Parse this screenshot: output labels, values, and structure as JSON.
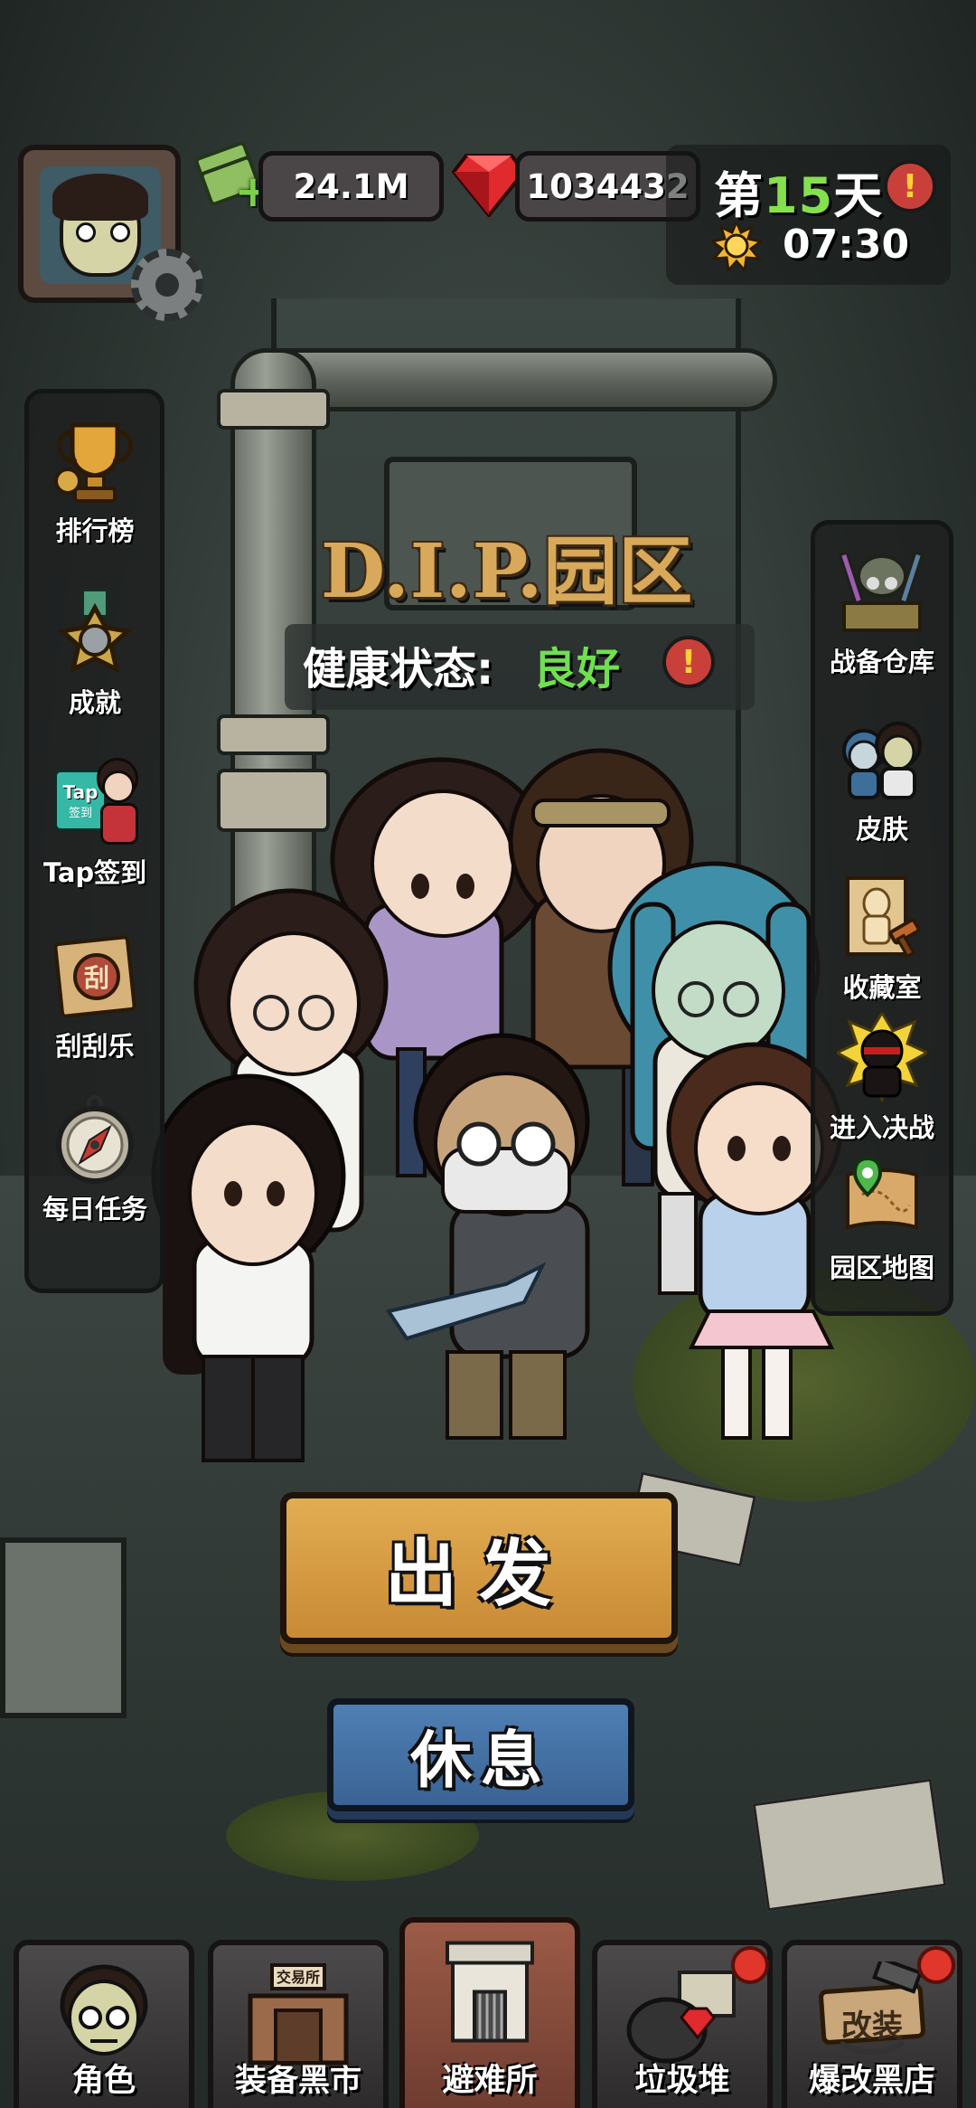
{
  "hud": {
    "money": "24.1M",
    "gems": "1034432",
    "day_prefix": "第",
    "day_number": "15",
    "day_suffix": "天",
    "time": "07:30",
    "alert_glyph": "!"
  },
  "title": "D.I.P.园区",
  "status": {
    "label": "健康状态:",
    "value": "良好",
    "value_color": "#6fe04e"
  },
  "left_menu": [
    {
      "label": "排行榜",
      "icon": "trophy-icon"
    },
    {
      "label": "成就",
      "icon": "medal-icon"
    },
    {
      "label": "Tap签到",
      "icon": "tap-checkin-icon",
      "badge": "Tap",
      "badge_sub": "签到"
    },
    {
      "label": "刮刮乐",
      "icon": "scratch-card-icon",
      "glyph": "刮"
    },
    {
      "label": "每日任务",
      "icon": "compass-icon"
    }
  ],
  "right_menu": [
    {
      "label": "战备仓库",
      "icon": "armory-icon"
    },
    {
      "label": "皮肤",
      "icon": "skin-icon"
    },
    {
      "label": "收藏室",
      "icon": "collection-icon"
    },
    {
      "label": "进入决战",
      "icon": "final-battle-icon"
    },
    {
      "label": "园区地图",
      "icon": "map-icon"
    }
  ],
  "buttons": {
    "go": "出发",
    "rest": "休息"
  },
  "bottom_nav": [
    {
      "label": "角色",
      "icon": "character-icon",
      "active": false,
      "dot": false
    },
    {
      "label": "装备黑市",
      "icon": "black-market-icon",
      "sign": "交易所",
      "active": false,
      "dot": false
    },
    {
      "label": "避难所",
      "icon": "shelter-icon",
      "active": true,
      "dot": false
    },
    {
      "label": "垃圾堆",
      "icon": "junk-pile-icon",
      "active": false,
      "dot": true
    },
    {
      "label": "爆改黑店",
      "icon": "mod-shop-icon",
      "sign": "改装",
      "active": false,
      "dot": true
    }
  ],
  "colors": {
    "accent_green": "#85e04d",
    "go_button": "#d99c45",
    "rest_button": "#4672a6",
    "active_tab": "#8a4f3e",
    "alert": "#c9403a"
  }
}
